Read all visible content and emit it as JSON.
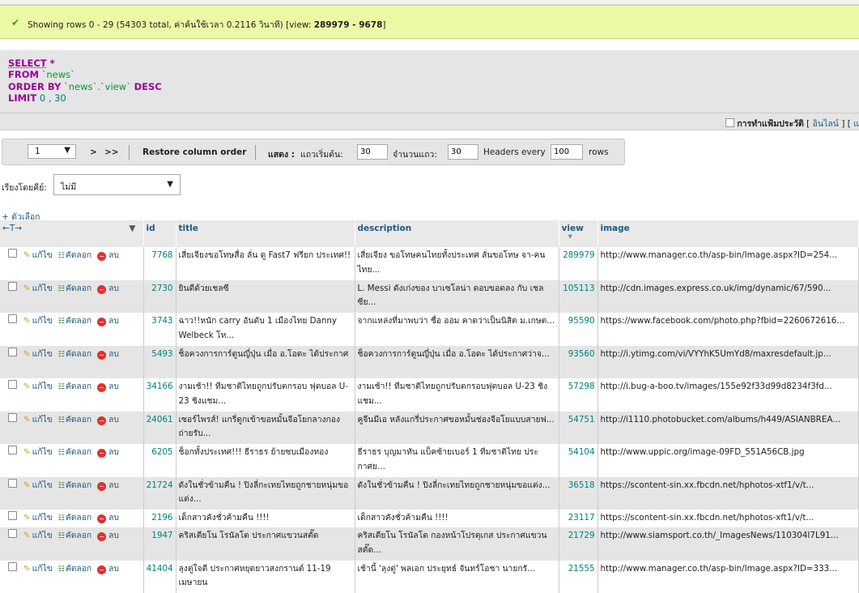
{
  "success": {
    "message_pre": "Showing rows 0 - 29 (54303 total, ค่าค้นใช้เวลา 0.2116 วินาที) [view: ",
    "view_range": "289979 - 9678",
    "message_post": "]"
  },
  "sql": {
    "select": "SELECT",
    "select_rest": " *",
    "from": "FROM",
    "table": "`news`",
    "orderby": "ORDER BY",
    "order_expr": "`news`.`view`",
    "desc": "DESC",
    "limit": "LIMIT",
    "limit_vals": "0 , 30"
  },
  "toolbar": {
    "history_label": "การทำแฟ้มประวัติ",
    "inline_open": "[",
    "inline_link": "อินไลน์",
    "inline_close": "] [",
    "more": "แ"
  },
  "nav": {
    "page_value": "1",
    "next": ">",
    "last": ">>",
    "restore": "Restore column order",
    "show_label": "แสดง :",
    "start_label": "แถวเริ่มต้น:",
    "start_value": "30",
    "count_label": "จำนวนแถว:",
    "count_value": "30",
    "headers_label": "Headers every",
    "headers_value": "100",
    "rows_label": "rows"
  },
  "sort": {
    "label": "เรียงโดยคีย์:",
    "value": "ไม่มี"
  },
  "options_label": "+ ตัวเลือก",
  "columns": {
    "id": "id",
    "title": "title",
    "description": "description",
    "view": "view",
    "image": "image"
  },
  "actions": {
    "edit": "แก้ไข",
    "copy": "คัดลอก",
    "delete": "ลบ"
  },
  "rows": [
    {
      "id": "7768",
      "title": "เสี่ยเจียงขอโทษสื่อ ลั่น ดู Fast7 ฟรียก ประเทศ!!",
      "description": "เสี่ยเจียง ขอโทษคนไทยทั้งประเทศ ลั่นขอโทษ จา-คนไทย...",
      "view": "289979",
      "image": "http://www.manager.co.th/asp-bin/Image.aspx?ID=254..."
    },
    {
      "id": "2730",
      "title": "ยินดีด้วยเชลซี",
      "description": "L. Messi ดังเก่งของ บาเซโลน่า ตอบขอตลง กับ เชลซีย...",
      "view": "105113",
      "image": "http://cdn.images.express.co.uk/img/dynamic/67/590..."
    },
    {
      "id": "3743",
      "title": "ฉาว!!หนัก carry อันดับ 1 เมืองไทย Danny Welbeck โห...",
      "description": "จากแหล่งที่มาพบว่า ชื่อ ออม คาดว่าเป็นนิสิต ม.เกษต...",
      "view": "95590",
      "image": "https://www.facebook.com/photo.php?fbid=2260672616..."
    },
    {
      "id": "5493",
      "title": "ช็อควงการการ์ตูนญี่ปุ่น เมื่อ อ.โอดะ ได้ประกาศ",
      "description": "ช็อควงการการ์ตูนญี่ปุ่น เมื่อ อ.โอดะ ได้ประกาศว่าจ...",
      "view": "93560",
      "image": "http://i.ytimg.com/vi/VYYhK5UmYd8/maxresdefault.jp..."
    },
    {
      "id": "34166",
      "title": "งามเช้า!! ทีมชาติไทยถูกปรับตกรอบ ฟุตบอล U-23 ชิงแชม...",
      "description": "งามเช้า!! ทีมชาติไทยถูกปรับตกรอบฟุตบอล U-23 ชิงแชม...",
      "view": "57298",
      "image": "http://i.bug-a-boo.tv/images/155e92f33d99d8234f3fd..."
    },
    {
      "id": "24061",
      "title": "เซอร์ไพรส์! แกรี่ดูกเข้าขอหมั้นจีอโยกลางกองถ่ายรับ...",
      "description": "คูจีนมีเอ หลังแกรี่ประกาศขอหมั้นช่องจีอโยแบบสายฟ...",
      "view": "54751",
      "image": "http://i1110.photobucket.com/albums/h449/ASIANBREA..."
    },
    {
      "id": "6205",
      "title": "ช็อกทั้งประเทศ!!! ธีราธร ย้ายซบเมืองทอง",
      "description": "ธีราธร บุญมาทัน แบ็คซ้ายเบอร์ 1 ทีมชาติไทย ประกาศย...",
      "view": "54104",
      "image": "http://www.uppic.org/image-09FD_551A56CB.jpg"
    },
    {
      "id": "21724",
      "title": "ดังในชั่วข้ามคืน ! ปิงลี่กะเทยไทยถูกชายหนุ่มขอแต่ง...",
      "description": "ดังในชั่วข้ามคืน ! ปิงลี่กะเทยไทยถูกชายหนุ่มขอแต่ง...",
      "view": "36518",
      "image": "https://scontent-sin.xx.fbcdn.net/hphotos-xtf1/v/t..."
    },
    {
      "id": "2196",
      "title": "เด็กสาวคังชั่วค้ามคืน !!!!",
      "description": "เด็กสาวคังชั่วค้ามคืน !!!!",
      "view": "23117",
      "image": "https://scontent-sin.xx.fbcdn.net/hphotos-xft1/v/t..."
    },
    {
      "id": "1947",
      "title": "คริสเตียโน โรนัลโด ประกาศแขวนสตั๊ด",
      "description": "คริสเตียโน โรนัลโด กองหน้าโปรตุเกส ประกาศแขวนสตั๊ด...",
      "view": "21729",
      "image": "http://www.siamsport.co.th/_ImagesNews/110304I7L91..."
    },
    {
      "id": "41404",
      "title": "ลุงตู่ใจดี ประกาศหยุดยาวสงกรานต์ 11-19 เมษายน",
      "description": "เช้านี้ 'ลุงตู่' พลเอก ประยุทธ์ จันทร์โอชา นายกรั...",
      "view": "21555",
      "image": "http://www.manager.co.th/asp-bin/Image.aspx?ID=333..."
    }
  ]
}
